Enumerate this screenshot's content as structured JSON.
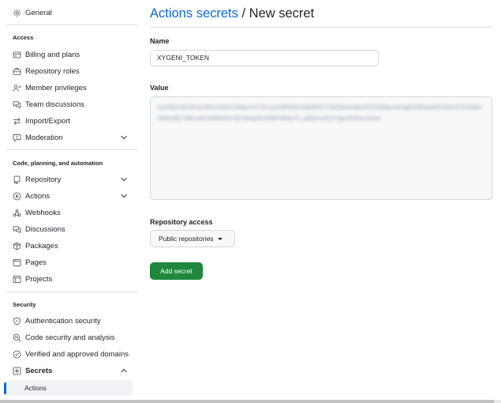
{
  "sidebar": {
    "top_item": {
      "label": "General",
      "icon": "gear-icon"
    },
    "access": {
      "heading": "Access",
      "items": [
        {
          "label": "Billing and plans",
          "icon": "credit-card-icon"
        },
        {
          "label": "Repository roles",
          "icon": "briefcase-icon"
        },
        {
          "label": "Member privileges",
          "icon": "person-icon"
        },
        {
          "label": "Team discussions",
          "icon": "comment-discussion-icon"
        },
        {
          "label": "Import/Export",
          "icon": "arrow-switch-icon"
        },
        {
          "label": "Moderation",
          "icon": "report-icon"
        }
      ]
    },
    "code": {
      "heading": "Code, planning, and automation",
      "items": [
        {
          "label": "Repository",
          "icon": "repo-icon"
        },
        {
          "label": "Actions",
          "icon": "play-icon"
        },
        {
          "label": "Webhooks",
          "icon": "webhook-icon"
        },
        {
          "label": "Discussions",
          "icon": "comment-discussion-icon"
        },
        {
          "label": "Packages",
          "icon": "package-icon"
        },
        {
          "label": "Pages",
          "icon": "browser-icon"
        },
        {
          "label": "Projects",
          "icon": "table-icon"
        }
      ]
    },
    "security": {
      "heading": "Security",
      "items": [
        {
          "label": "Authentication security",
          "icon": "shield-lock-icon"
        },
        {
          "label": "Code security and analysis",
          "icon": "codescan-icon"
        },
        {
          "label": "Verified and approved domains",
          "icon": "verified-icon"
        },
        {
          "label": "Secrets",
          "icon": "key-asterisk-icon"
        }
      ],
      "sub_items": [
        {
          "label": "Actions"
        }
      ]
    }
  },
  "main": {
    "breadcrumb_link": "Actions secrets",
    "breadcrumb_sep": "/",
    "title": "New secret",
    "name_label": "Name",
    "name_value": "XYGENI_TOKEN",
    "value_label": "Value",
    "value_text": "eyJhbGciOiJIUzI1NiIsInR5cCI6IkpXVCJ9.eyJzdWIiOiIxMjM0NTY3ODkwIiwibmFtZSI6IkpvaG4gRG9lIiwiaWF0IjoxNTE2MjM5MDIyfQ.SflKxwRJSMeKKF2QT4fwpMeJf36POk6yJV_adQssw5cXYgeniTokenValue",
    "access_label": "Repository access",
    "access_selected": "Public repositories",
    "submit_label": "Add secret"
  },
  "colors": {
    "accent": "#0969da",
    "primary_button": "#1f883d"
  }
}
